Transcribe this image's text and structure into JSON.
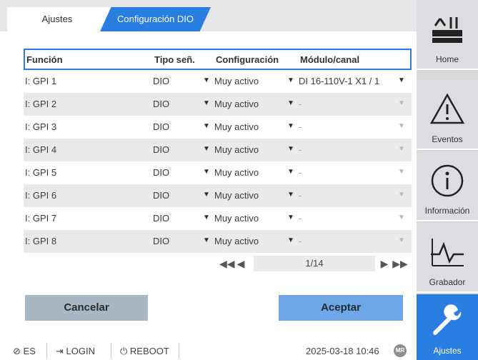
{
  "tabs": {
    "ajustes": "Ajustes",
    "dio": "Configuración DIO"
  },
  "table": {
    "headers": {
      "funcion": "Función",
      "tipo": "Tipo señ.",
      "config": "Configuración",
      "modulo": "Módulo/canal"
    },
    "rows": [
      {
        "funcion": "I: GPI 1",
        "tipo": "DIO",
        "config": "Muy activo",
        "modulo": "DI 16-110V-1 X1 / 1"
      },
      {
        "funcion": "I: GPI 2",
        "tipo": "DIO",
        "config": "Muy activo",
        "modulo": "-"
      },
      {
        "funcion": "I: GPI 3",
        "tipo": "DIO",
        "config": "Muy activo",
        "modulo": "-"
      },
      {
        "funcion": "I: GPI 4",
        "tipo": "DIO",
        "config": "Muy activo",
        "modulo": "-"
      },
      {
        "funcion": "I: GPI 5",
        "tipo": "DIO",
        "config": "Muy activo",
        "modulo": "-"
      },
      {
        "funcion": "I: GPI 6",
        "tipo": "DIO",
        "config": "Muy activo",
        "modulo": "-"
      },
      {
        "funcion": "I: GPI 7",
        "tipo": "DIO",
        "config": "Muy activo",
        "modulo": "-"
      },
      {
        "funcion": "I: GPI 8",
        "tipo": "DIO",
        "config": "Muy activo",
        "modulo": "-"
      }
    ]
  },
  "pager": {
    "page": "1/14"
  },
  "buttons": {
    "cancel": "Cancelar",
    "accept": "Aceptar"
  },
  "footer": {
    "lang": "ES",
    "login": "LOGIN",
    "reboot": "REBOOT",
    "datetime": "2025-03-18 10:46",
    "badge": "MR"
  },
  "nav": {
    "home": "Home",
    "eventos": "Eventos",
    "info": "Información",
    "grabador": "Grabador",
    "ajustes": "Ajustes"
  },
  "colors": {
    "accent": "#2a7de1",
    "cancel": "#a9b7c5",
    "accept": "#6ea6e8"
  }
}
